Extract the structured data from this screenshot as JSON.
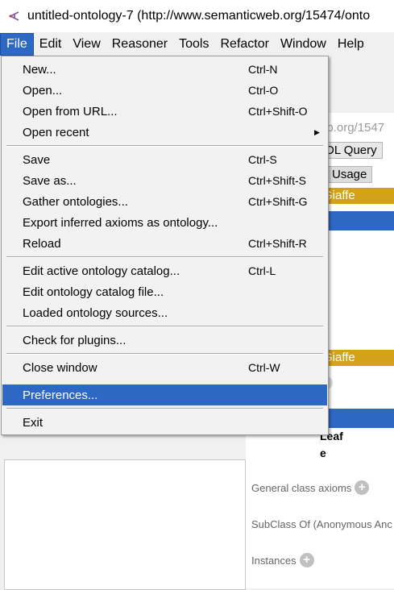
{
  "window": {
    "title": "untitled-ontology-7 (http://www.semanticweb.org/15474/onto"
  },
  "menubar": {
    "items": [
      "File",
      "Edit",
      "View",
      "Reasoner",
      "Tools",
      "Refactor",
      "Window",
      "Help"
    ],
    "active": "File"
  },
  "file_menu": {
    "items": [
      {
        "label": "New...",
        "shortcut": "Ctrl-N"
      },
      {
        "label": "Open...",
        "shortcut": "Ctrl-O"
      },
      {
        "label": "Open from URL...",
        "shortcut": "Ctrl+Shift-O"
      },
      {
        "label": "Open recent",
        "shortcut": ""
      },
      {
        "label": "Save",
        "shortcut": "Ctrl-S"
      },
      {
        "label": "Save as...",
        "shortcut": "Ctrl+Shift-S"
      },
      {
        "label": "Gather ontologies...",
        "shortcut": "Ctrl+Shift-G"
      },
      {
        "label": "Export inferred axioms as ontology...",
        "shortcut": ""
      },
      {
        "label": "Reload",
        "shortcut": "Ctrl+Shift-R"
      },
      {
        "label": "Edit active ontology catalog...",
        "shortcut": "Ctrl-L"
      },
      {
        "label": "Edit ontology catalog file...",
        "shortcut": ""
      },
      {
        "label": "Loaded ontology sources...",
        "shortcut": ""
      },
      {
        "label": "Check for plugins...",
        "shortcut": ""
      },
      {
        "label": "Close window",
        "shortcut": "Ctrl-W"
      },
      {
        "label": "Preferences...",
        "shortcut": ""
      },
      {
        "label": "Exit",
        "shortcut": ""
      }
    ],
    "highlighted": "Preferences..."
  },
  "background": {
    "url_fragment": "eb.org/1547",
    "tab_query": "DL Query",
    "tab_usage": "Usage",
    "gold_label_1": "Giaffe",
    "gold_label_2": "Giaffe",
    "bold_1": "Leaf",
    "bold_2": "e",
    "section_general": "General class axioms",
    "section_subclass": "SubClass Of (Anonymous Anc",
    "section_instances": "Instances"
  },
  "colors": {
    "accent": "#2e68c5",
    "gold": "#d4a21a"
  }
}
